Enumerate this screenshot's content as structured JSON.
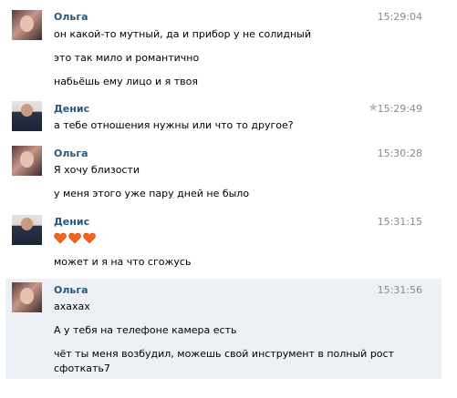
{
  "messages": [
    {
      "author": "Ольга",
      "time": "15:29:04",
      "lines": [
        "он какой-то мутный, да и прибор у не солидный",
        "это так мило и романтично",
        "набьёшь ему лицо и я твоя"
      ]
    },
    {
      "author": "Денис",
      "time": "15:29:49",
      "star_icon": "star-icon",
      "lines": [
        "а тебе отношения нужны или что то другое?"
      ]
    },
    {
      "author": "Ольга",
      "time": "15:30:28",
      "lines": [
        "Я хочу близости",
        "у меня этого уже пару дней не было"
      ]
    },
    {
      "author": "Денис",
      "time": "15:31:15",
      "emoji": [
        "heart-icon",
        "heart-icon",
        "heart-icon"
      ],
      "lines": [
        "может и я на что сгожусь"
      ]
    },
    {
      "author": "Ольга",
      "time": "15:31:56",
      "highlighted": true,
      "lines": [
        "ахахах",
        "А у тебя на телефоне камера есть",
        "чёт ты меня возбудил, можешь свой инструмент в полный рост",
        "сфоткать7"
      ]
    }
  ],
  "colors": {
    "name": "#2b587a",
    "time": "#8a8a8a",
    "highlight_bg": "#edf1f5",
    "heart": "#f0641e"
  }
}
